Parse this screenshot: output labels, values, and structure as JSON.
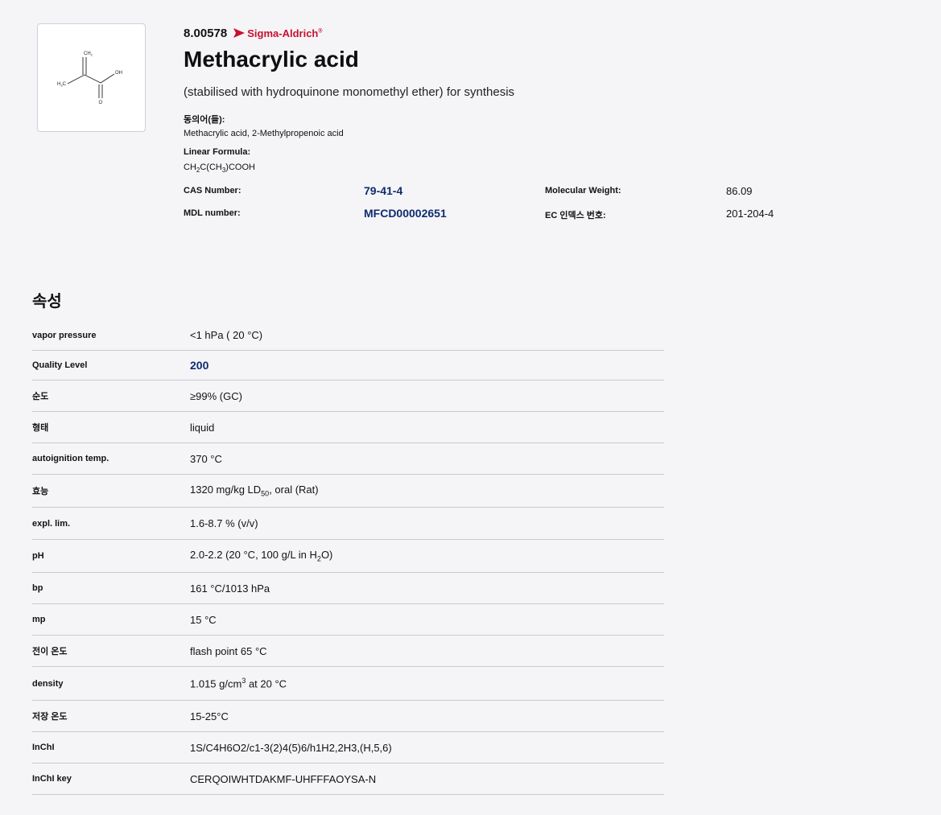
{
  "structure": {
    "labels": {
      "ch2": "CH",
      "ch2_sub": "2",
      "h3c": "H",
      "h3c_sub": "3",
      "h3c_c": "C",
      "oh": "OH",
      "o": "O"
    }
  },
  "product": {
    "number": "8.00578",
    "brand": "Sigma-Aldrich",
    "brand_reg": "®",
    "title": "Methacrylic acid",
    "subtitle": "(stabilised with hydroquinone monomethyl ether) for synthesis"
  },
  "synonyms": {
    "label": "동의어(들):",
    "value": "Methacrylic acid, 2-Methylpropenoic acid"
  },
  "linear_formula": {
    "label": "Linear Formula:",
    "p1": "CH",
    "s1": "2",
    "p2": "C(CH",
    "s2": "3",
    "p3": ")COOH"
  },
  "identifiers": {
    "cas_label": "CAS Number:",
    "cas_value": "79-41-4",
    "mw_label": "Molecular Weight:",
    "mw_value": "86.09",
    "mdl_label": "MDL number:",
    "mdl_value": "MFCD00002651",
    "ec_label": "EC 인덱스 번호:",
    "ec_value": "201-204-4"
  },
  "properties": {
    "title": "속성",
    "rows": [
      {
        "name": "vapor pressure",
        "value": "<1 hPa ( 20 °C)"
      },
      {
        "name": "Quality Level",
        "value": "200"
      },
      {
        "name": "순도",
        "value": "≥99% (GC)"
      },
      {
        "name": "형태",
        "value": "liquid"
      },
      {
        "name": "autoignition temp.",
        "value": "370 °C"
      },
      {
        "name": "효능",
        "v1": "1320 mg/kg LD",
        "sub": "50",
        "v2": ", oral (Rat)"
      },
      {
        "name": "expl. lim.",
        "value": "1.6-8.7 % (v/v)"
      },
      {
        "name": "pH",
        "v1": "2.0-2.2 (20 °C, 100 g/L in H",
        "sub": "2",
        "v2": "O)"
      },
      {
        "name": "bp",
        "value": "161 °C/1013 hPa"
      },
      {
        "name": "mp",
        "value": "15 °C"
      },
      {
        "name": "전이 온도",
        "value": "flash point 65 °C"
      },
      {
        "name": "density",
        "v1": "1.015 g/cm",
        "sup": "3",
        "v2": " at 20 °C"
      },
      {
        "name": "저장 온도",
        "value": "15-25°C"
      },
      {
        "name": "InChI",
        "value": "1S/C4H6O2/c1-3(2)4(5)6/h1H2,2H3,(H,5,6)"
      },
      {
        "name": "InChI key",
        "value": "CERQOIWHTDAKMF-UHFFFAOYSA-N"
      }
    ]
  },
  "colors": {
    "link": "#0f2c6e",
    "brand": "#c8102e",
    "divider": "#c9c9cf",
    "background": "#f5f5f8"
  }
}
